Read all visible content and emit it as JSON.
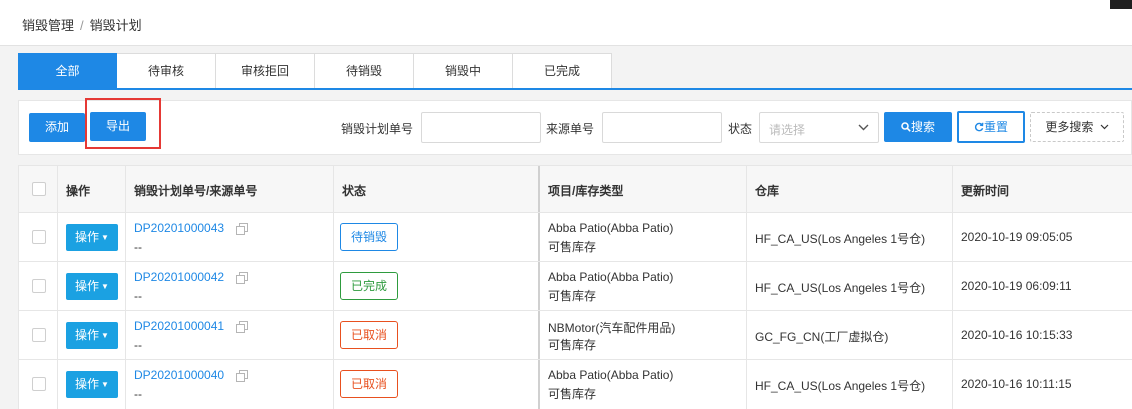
{
  "breadcrumb": {
    "parent": "销毁管理",
    "separator": "/",
    "current": "销毁计划"
  },
  "tabs": [
    {
      "label": "全部",
      "active": true
    },
    {
      "label": "待审核",
      "active": false
    },
    {
      "label": "审核拒回",
      "active": false
    },
    {
      "label": "待销毁",
      "active": false
    },
    {
      "label": "销毁中",
      "active": false
    },
    {
      "label": "已完成",
      "active": false
    }
  ],
  "toolbar": {
    "add_label": "添加",
    "export_label": "导出"
  },
  "filters": {
    "plan_no_label": "销毁计划单号",
    "plan_no_value": "",
    "source_no_label": "来源单号",
    "source_no_value": "",
    "status_label": "状态",
    "status_placeholder": "请选择",
    "search_label": "搜索",
    "reset_label": "重置",
    "more_label": "更多搜索"
  },
  "table": {
    "columns": [
      "操作",
      "销毁计划单号/来源单号",
      "状态",
      "项目/库存类型",
      "仓库",
      "更新时间"
    ],
    "op_label": "操作",
    "rows": [
      {
        "plan_no": "DP20201000043",
        "source_no": "--",
        "status": "待销毁",
        "status_type": "pending",
        "project": "Abba Patio(Abba Patio)",
        "stock_type": "可售库存",
        "warehouse": "HF_CA_US(Los Angeles 1号仓)",
        "updated": "2020-10-19 09:05:05"
      },
      {
        "plan_no": "DP20201000042",
        "source_no": "--",
        "status": "已完成",
        "status_type": "done",
        "project": "Abba Patio(Abba Patio)",
        "stock_type": "可售库存",
        "warehouse": "HF_CA_US(Los Angeles 1号仓)",
        "updated": "2020-10-19 06:09:11"
      },
      {
        "plan_no": "DP20201000041",
        "source_no": "--",
        "status": "已取消",
        "status_type": "cancel",
        "project": "NBMotor(汽车配件用品)",
        "stock_type": "可售库存",
        "warehouse": "GC_FG_CN(工厂虚拟仓)",
        "updated": "2020-10-16 10:15:33"
      },
      {
        "plan_no": "DP20201000040",
        "source_no": "--",
        "status": "已取消",
        "status_type": "cancel",
        "project": "Abba Patio(Abba Patio)",
        "stock_type": "可售库存",
        "warehouse": "HF_CA_US(Los Angeles 1号仓)",
        "updated": "2020-10-16 10:11:15"
      }
    ]
  },
  "colors": {
    "primary": "#1e88e5",
    "operation_button": "#1ba1e2",
    "status_pending": "#1e88e5",
    "status_done": "#2e9b3e",
    "status_cancel": "#e8501f",
    "highlight": "#e53935"
  }
}
